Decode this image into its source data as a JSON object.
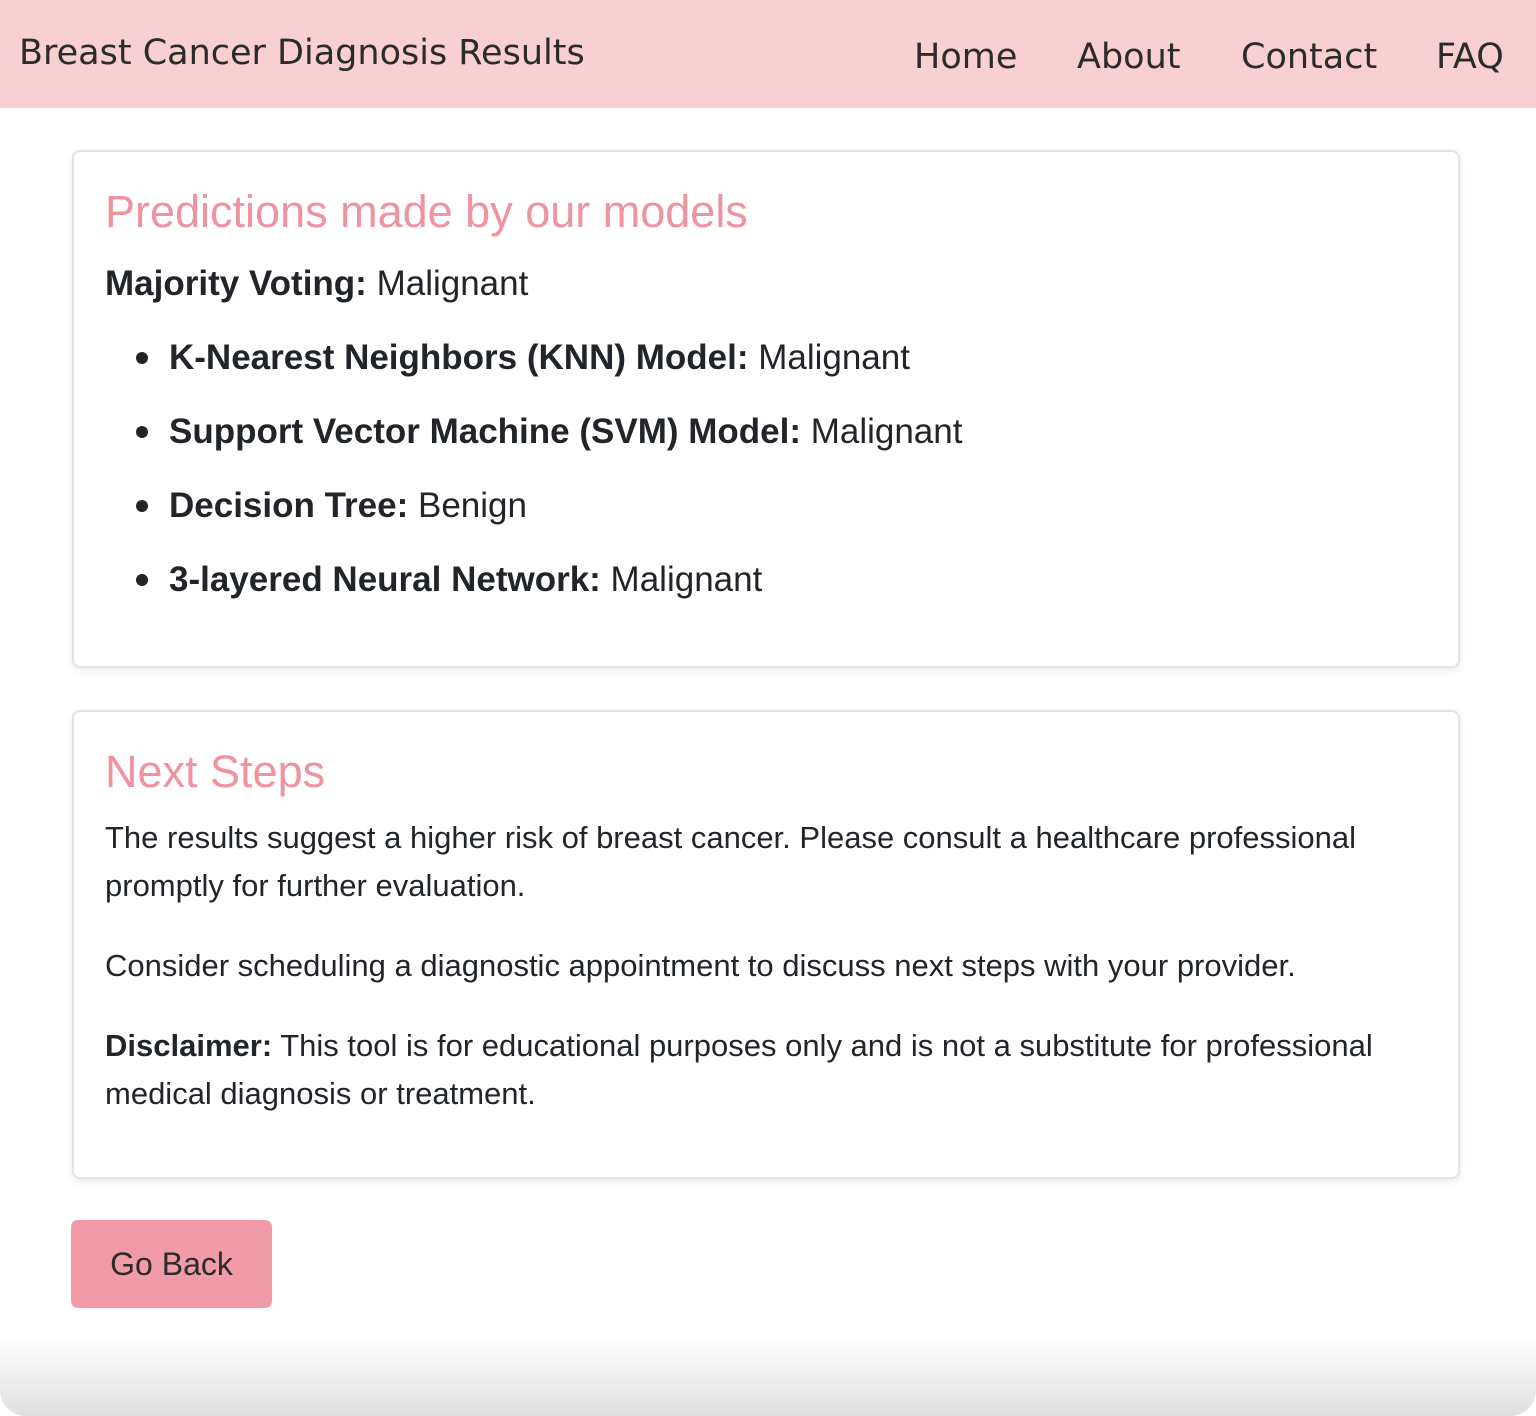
{
  "navbar": {
    "brand": "Breast Cancer Diagnosis Results",
    "links": [
      "Home",
      "About",
      "Contact",
      "FAQ"
    ]
  },
  "predictions": {
    "title": "Predictions made by our models",
    "majority_label": "Majority Voting:",
    "majority_value": " Malignant",
    "models": [
      {
        "label": "K-Nearest Neighbors (KNN) Model:",
        "value": " Malignant"
      },
      {
        "label": "Support Vector Machine (SVM) Model:",
        "value": " Malignant"
      },
      {
        "label": "Decision Tree:",
        "value": " Benign"
      },
      {
        "label": "3-layered Neural Network:",
        "value": " Malignant"
      }
    ]
  },
  "next_steps": {
    "title": "Next Steps",
    "paragraph1": "The results suggest a higher risk of breast cancer. Please consult a healthcare professional promptly for further evaluation.",
    "paragraph2": "Consider scheduling a diagnostic appointment to discuss next steps with your provider.",
    "disclaimer_label": "Disclaimer:",
    "disclaimer_text": " This tool is for educational purposes only and is not a substitute for professional medical diagnosis or treatment."
  },
  "actions": {
    "back_label": "Go Back"
  },
  "colors": {
    "navbar_bg": "#f8d0d1",
    "heading": "#ee939f",
    "button_bg": "#f19ba7"
  }
}
